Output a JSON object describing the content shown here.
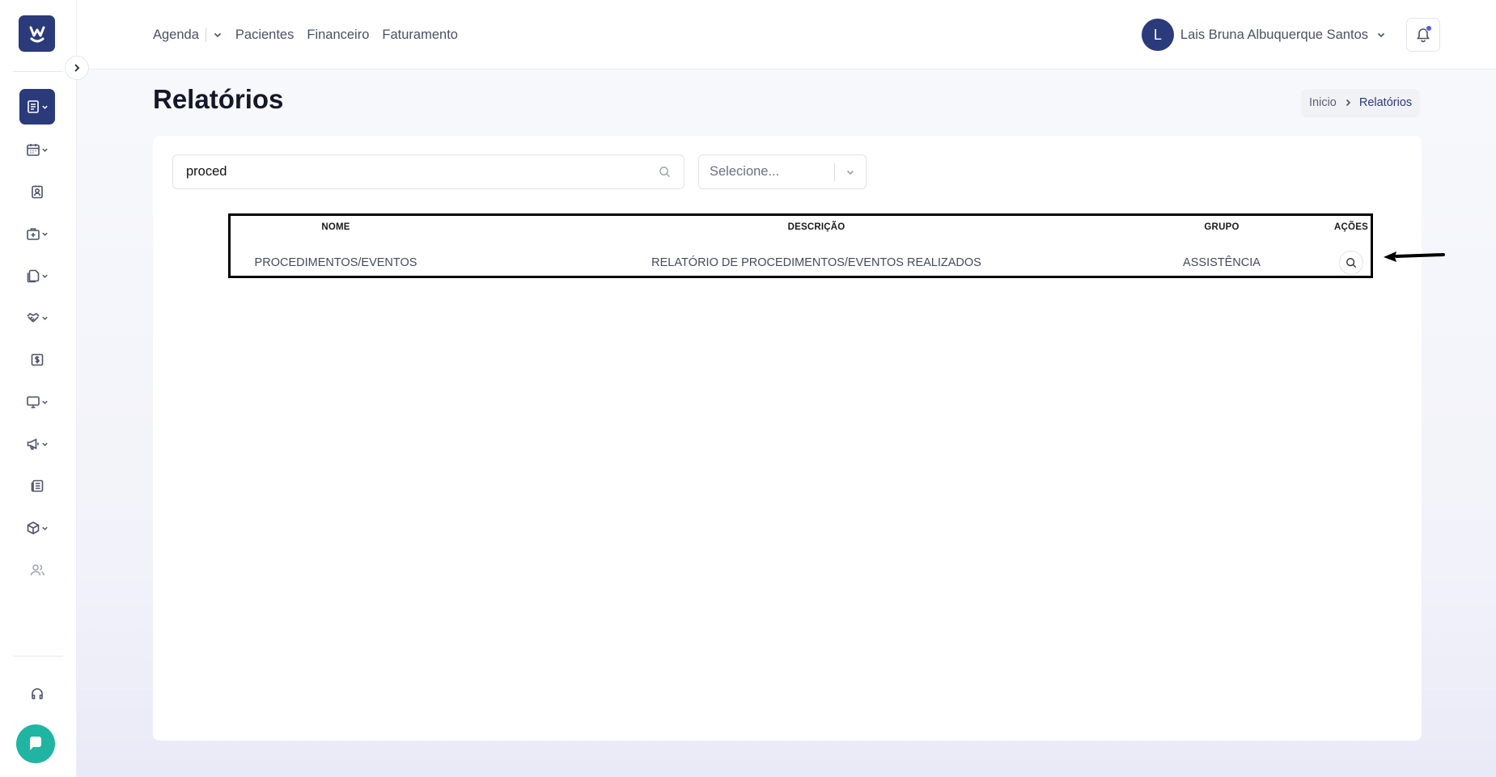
{
  "nav_menu": {
    "agenda": "Agenda",
    "pacientes": "Pacientes",
    "financeiro": "Financeiro",
    "faturamento": "Faturamento"
  },
  "user": {
    "initial": "L",
    "name": "Lais Bruna Albuquerque Santos"
  },
  "page": {
    "title": "Relatórios"
  },
  "breadcrumb": {
    "home": "Inicio",
    "current": "Relatórios"
  },
  "filters": {
    "search_value": "proced",
    "select_placeholder": "Selecione..."
  },
  "table": {
    "headers": {
      "nome": "NOME",
      "descricao": "DESCRIÇÃO",
      "grupo": "GRUPO",
      "acoes": "AÇÕES"
    },
    "rows": [
      {
        "nome": "PROCEDIMENTOS/EVENTOS",
        "descricao": "RELATÓRIO DE PROCEDIMENTOS/EVENTOS REALIZADOS",
        "grupo": "ASSISTÊNCIA"
      }
    ]
  },
  "colors": {
    "brand": "#2b3a7a",
    "chat": "#1fb5a2",
    "notification_dot": "#5b54e8"
  },
  "icons": [
    "logo-icon",
    "chevron-right-icon",
    "reports-icon",
    "calendar-icon",
    "patient-card-icon",
    "medical-bag-icon",
    "documents-icon",
    "handshake-icon",
    "dollar-icon",
    "monitor-icon",
    "megaphone-icon",
    "newspaper-icon",
    "box-icon",
    "users-icon",
    "headset-icon",
    "chat-icon",
    "bell-icon",
    "search-icon",
    "chevron-down-icon",
    "arrow-left-icon"
  ]
}
